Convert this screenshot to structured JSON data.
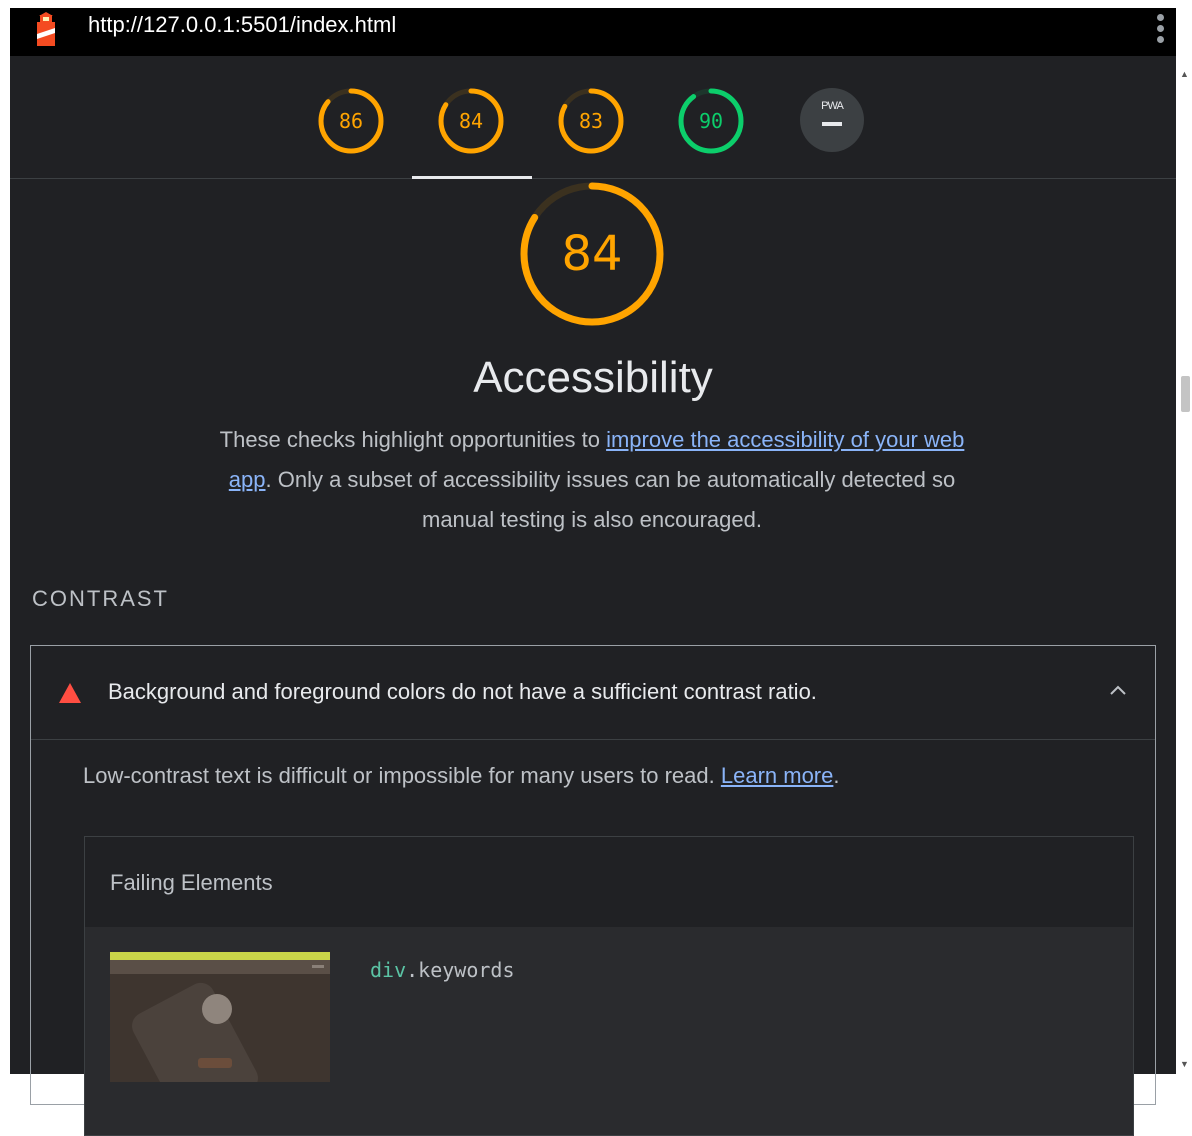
{
  "browser": {
    "url": "http://127.0.0.1:5501/index.html"
  },
  "colors": {
    "average": "#ffa400",
    "pass": "#0cce6b",
    "fail": "#ff4e42",
    "link": "#8ab4f8"
  },
  "gauges": [
    {
      "score": "86",
      "value": 86,
      "status": "average"
    },
    {
      "score": "84",
      "value": 84,
      "status": "average",
      "selected": true
    },
    {
      "score": "83",
      "value": 83,
      "status": "average"
    },
    {
      "score": "90",
      "value": 90,
      "status": "pass"
    }
  ],
  "pwa": {
    "label": "PWA",
    "icon": "dash-icon"
  },
  "category": {
    "score": "84",
    "value": 84,
    "title": "Accessibility",
    "desc_before": "These checks highlight opportunities to ",
    "desc_link": "improve the accessibility of your web app",
    "desc_after": ". Only a subset of accessibility issues can be automatically detected so manual testing is also encouraged."
  },
  "group": {
    "title": "CONTRAST"
  },
  "audit": {
    "icon": "fail-triangle-icon",
    "title": "Background and foreground colors do not have a sufficient contrast ratio.",
    "desc_before": "Low-contrast text is difficult or impossible for many users to read. ",
    "desc_link": "Learn more",
    "desc_after": ".",
    "details_title": "Failing Elements",
    "items": [
      {
        "selector_tag": "div",
        "selector_dot": ".",
        "selector_class": "keywords"
      }
    ]
  }
}
